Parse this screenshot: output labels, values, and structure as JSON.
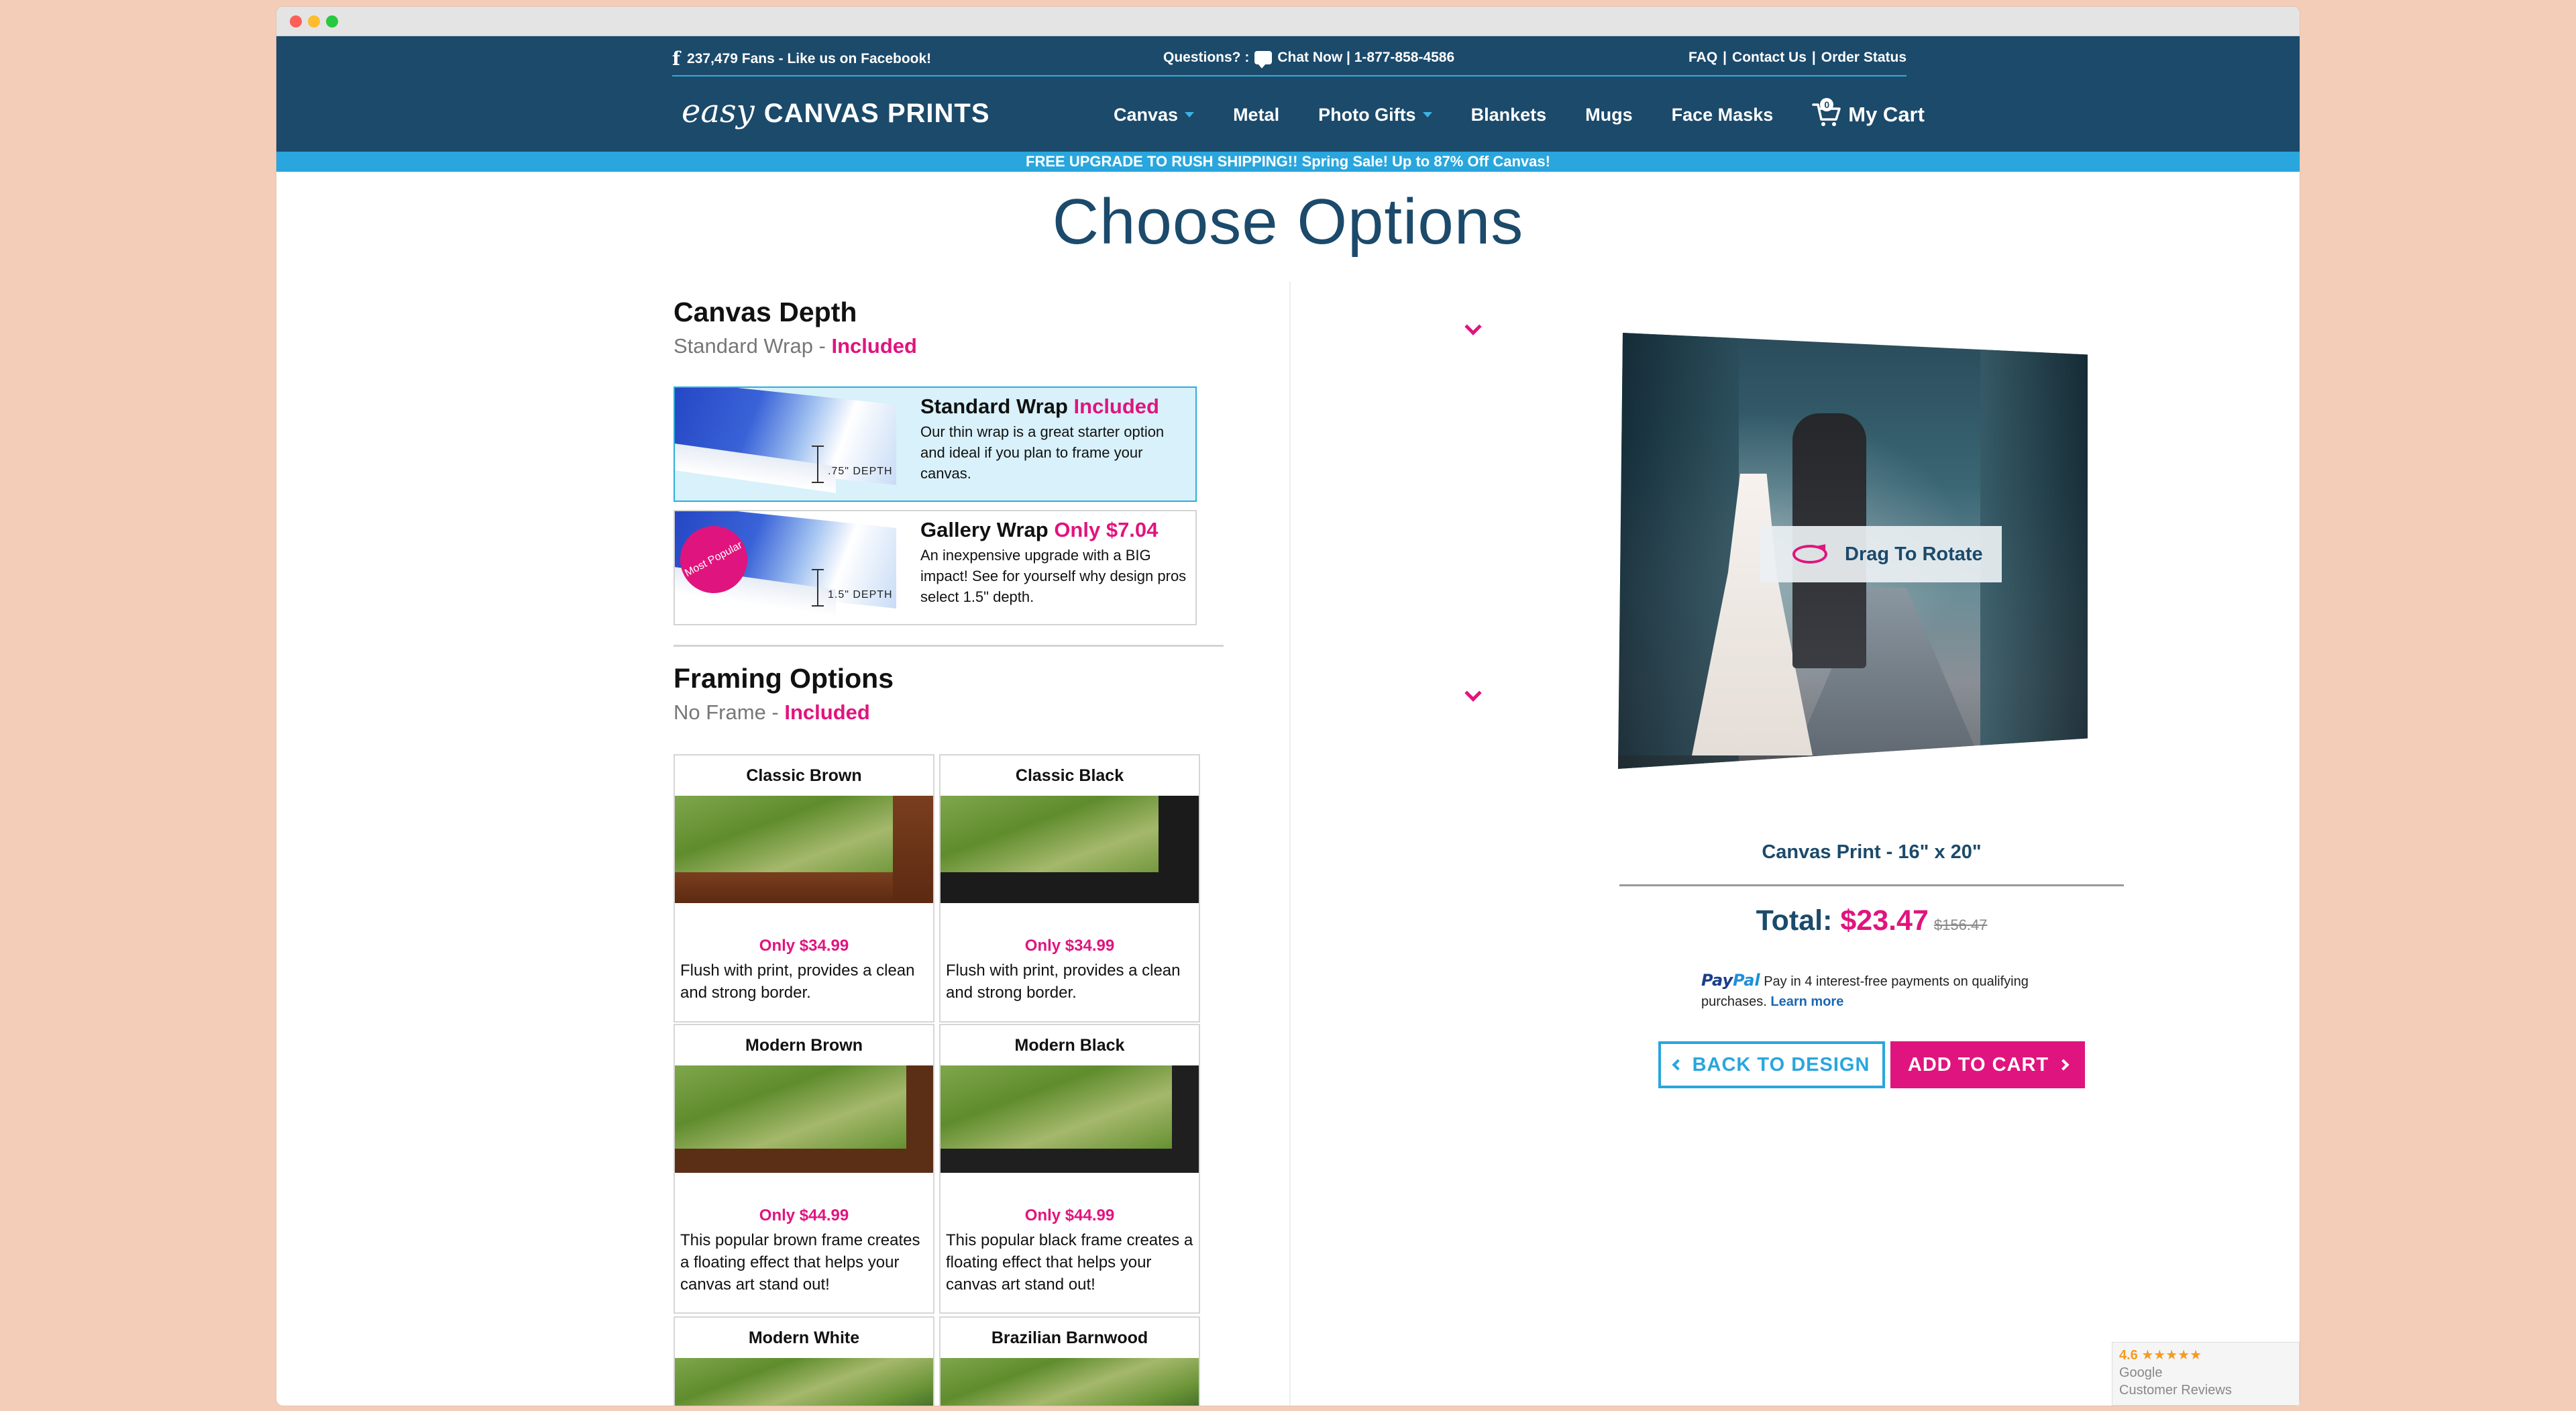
{
  "topbar": {
    "facebook_icon": "f",
    "fans": "237,479 Fans - Like us on Facebook!",
    "questions_label": "Questions? :",
    "chat": "Chat Now | 1-877-858-4586",
    "faq": "FAQ",
    "contact": "Contact Us",
    "order_status": "Order Status",
    "separator": "|"
  },
  "logo": {
    "easy": "easy",
    "brand": "CANVAS PRINTS"
  },
  "nav": {
    "items": [
      {
        "label": "Canvas",
        "dropdown": true
      },
      {
        "label": "Metal",
        "dropdown": false
      },
      {
        "label": "Photo Gifts",
        "dropdown": true
      },
      {
        "label": "Blankets",
        "dropdown": false
      },
      {
        "label": "Mugs",
        "dropdown": false
      },
      {
        "label": "Face Masks",
        "dropdown": false
      }
    ],
    "cart_label": "My Cart",
    "cart_count": "0"
  },
  "promo": "FREE UPGRADE TO RUSH SHIPPING!! Spring Sale! Up to 87% Off Canvas!",
  "page_title": "Choose Options",
  "canvas_depth": {
    "title": "Canvas Depth",
    "selected": "Standard Wrap",
    "sep": " - ",
    "selected_price": "Included",
    "options": [
      {
        "name": "Standard Wrap",
        "price": "Included",
        "desc": "Our thin wrap is a great starter option and ideal if you plan to frame your canvas.",
        "depth_label": ".75\" DEPTH",
        "selected": true
      },
      {
        "name": "Gallery Wrap",
        "price": "Only $7.04",
        "desc": "An inexpensive upgrade with a BIG impact! See for yourself why design pros select 1.5\" depth.",
        "depth_label": "1.5\" DEPTH",
        "badge": "Most Popular",
        "selected": false
      }
    ]
  },
  "framing": {
    "title": "Framing Options",
    "selected": "No Frame",
    "sep": " - ",
    "selected_price": "Included",
    "frames": [
      {
        "name": "Classic Brown",
        "price": "Only $34.99",
        "desc": "Flush with print, provides a clean and strong border."
      },
      {
        "name": "Classic Black",
        "price": "Only $34.99",
        "desc": "Flush with print, provides a clean and strong border."
      },
      {
        "name": "Modern Brown",
        "price": "Only $44.99",
        "desc": "This popular brown frame creates a floating effect that helps your canvas art stand out!"
      },
      {
        "name": "Modern Black",
        "price": "Only $44.99",
        "desc": "This popular black frame creates a floating effect that helps your canvas art stand out!"
      },
      {
        "name": "Modern White"
      },
      {
        "name": "Brazilian Barnwood"
      }
    ]
  },
  "preview": {
    "drag_label": "Drag To Rotate",
    "product": "Canvas Print - 16\" x 20\"",
    "total_label": "Total:",
    "total": "$23.47",
    "old_price": "$156.47"
  },
  "paypal": {
    "logo_pay": "Pay",
    "logo_pal": "Pal",
    "text": "Pay in 4 interest-free payments on qualifying purchases.",
    "learn_more": "Learn more"
  },
  "buttons": {
    "back": "BACK TO DESIGN",
    "add": "ADD TO CART"
  },
  "reviews": {
    "score": "4.6",
    "stars": "★★★★★",
    "line1": "Google",
    "line2": "Customer Reviews"
  },
  "colors": {
    "navy": "#1b4a6b",
    "accent_blue": "#29a6dd",
    "magenta": "#e0147e",
    "page_bg": "#f4cdb8"
  }
}
